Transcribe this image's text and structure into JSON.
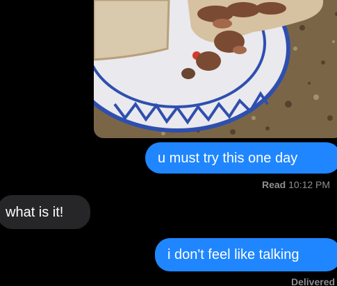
{
  "conversation": {
    "messages": [
      {
        "side": "outgoing",
        "type": "photo",
        "alt_icon": "photo-attachment"
      },
      {
        "side": "outgoing",
        "type": "text",
        "text": "u must try this one day"
      },
      {
        "side": "incoming",
        "type": "text",
        "text": "what is it!"
      },
      {
        "side": "outgoing",
        "type": "text",
        "text": "i don't feel like talking"
      }
    ],
    "receipts": {
      "read_label": "Read",
      "read_time": "10:12 PM",
      "delivered_label": "Delivered"
    }
  },
  "colors": {
    "background": "#000000",
    "outgoing_bubble": "#1f86ff",
    "incoming_bubble": "#262629",
    "receipt_text": "#8e8e93"
  }
}
